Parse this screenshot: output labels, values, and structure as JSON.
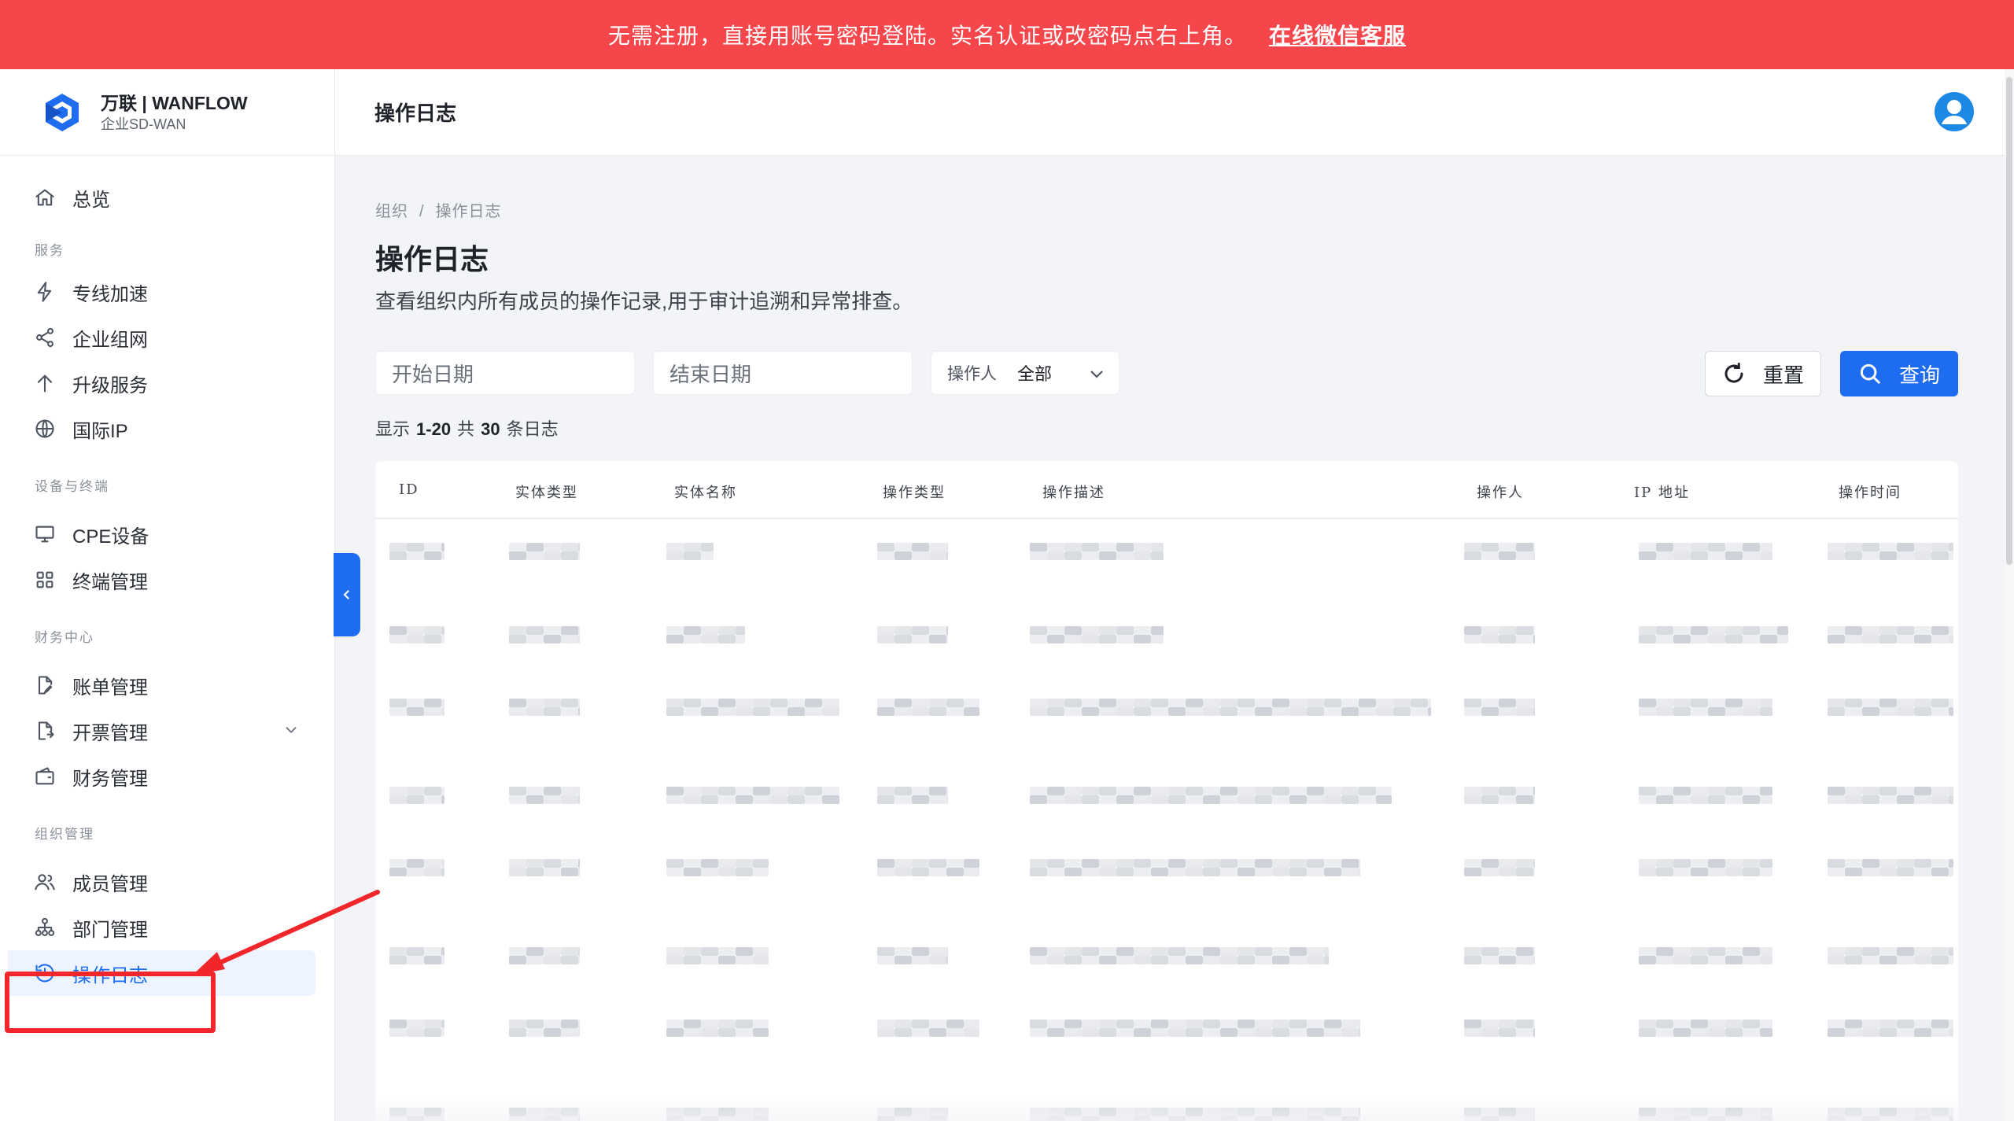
{
  "banner": {
    "text": "无需注册，直接用账号密码登陆。实名认证或改密码点右上角。",
    "link": "在线微信客服"
  },
  "brand": {
    "name": "万联 | WANFLOW",
    "sub": "企业SD-WAN"
  },
  "sidebar": {
    "overview": "总览",
    "groups": {
      "service": "服务",
      "device": "设备与终端",
      "finance": "财务中心",
      "org": "组织管理"
    },
    "items": {
      "dedicated": "专线加速",
      "network": "企业组网",
      "upgrade": "升级服务",
      "intl_ip": "国际IP",
      "cpe": "CPE设备",
      "terminal": "终端管理",
      "bill": "账单管理",
      "invoice": "开票管理",
      "finance": "财务管理",
      "member": "成员管理",
      "dept": "部门管理",
      "oplog": "操作日志"
    }
  },
  "header": {
    "title": "操作日志"
  },
  "breadcrumb": {
    "org": "组织",
    "sep": "/",
    "current": "操作日志"
  },
  "page": {
    "title": "操作日志",
    "desc": "查看组织内所有成员的操作记录,用于审计追溯和异常排查。"
  },
  "filters": {
    "start_placeholder": "开始日期",
    "end_placeholder": "结束日期",
    "operator_label": "操作人",
    "operator_value": "全部",
    "reset": "重置",
    "query": "查询"
  },
  "summary": {
    "prefix": "显示",
    "range": "1-20",
    "mid": "共",
    "total": "30",
    "suffix": "条日志"
  },
  "table": {
    "columns": [
      "ID",
      "实体类型",
      "实体名称",
      "操作类型",
      "操作描述",
      "操作人",
      "IP 地址",
      "操作时间"
    ]
  },
  "colors": {
    "banner": "#f5474b",
    "accent": "#1e6cf0",
    "annotation": "#f0262b"
  }
}
